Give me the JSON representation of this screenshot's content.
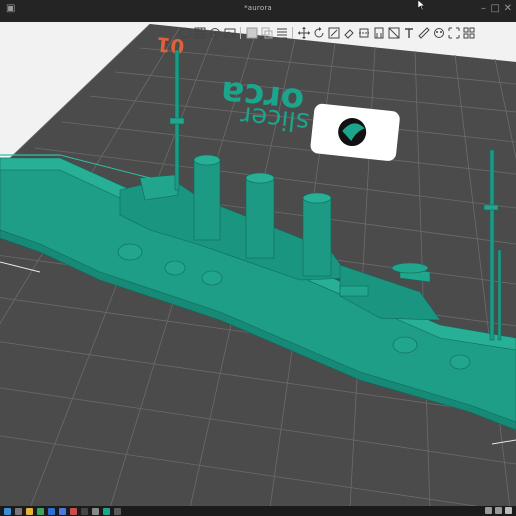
{
  "window": {
    "title": "*aurora"
  },
  "plate": {
    "number": "01",
    "logo_line1": "orca",
    "logo_line2": "slicer"
  },
  "colors": {
    "model": "#1c9a84",
    "plate_bg": "#4a4a4a",
    "grid": "#6a6a6a",
    "logo_teal": "#18a58c",
    "plate_number": "#e0603a",
    "sky": "#f2f2f2"
  },
  "toolbar": {
    "icons": [
      "cube-add-icon",
      "grid-icon",
      "orient-icon",
      "picture-icon",
      "layers-icon",
      "copy-icon",
      "list-icon",
      "move-icon",
      "rotate-icon",
      "scale-icon",
      "eraser-icon",
      "cut-icon",
      "support-paint-icon",
      "seam-paint-icon",
      "text-icon",
      "measure-icon",
      "color-paint-icon",
      "assembly-icon"
    ]
  },
  "taskbar": {
    "icons": [
      "start-icon",
      "search-icon",
      "explorer-icon",
      "browser-icon",
      "mail-icon",
      "store-icon",
      "app-icon",
      "terminal-icon",
      "settings-icon",
      "orca-icon",
      "calc-icon"
    ]
  }
}
